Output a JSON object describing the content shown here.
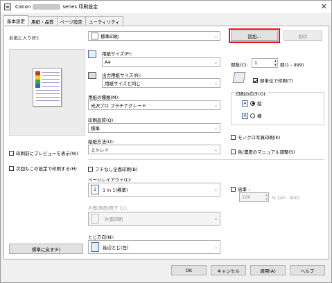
{
  "window": {
    "title_prefix": "Canon",
    "title_suffix": "series 印刷設定",
    "close": "✕"
  },
  "tabs": [
    "基本設定",
    "用紙・品質",
    "ページ設定",
    "ユーティリティ"
  ],
  "favorites": {
    "label": "お気に入り(E):",
    "value": "標準印刷",
    "add_button": "追加...",
    "delete_button": "削除"
  },
  "paper_size": {
    "label": "用紙サイズ(P):",
    "value": "A4"
  },
  "output_size": {
    "label": "出力用紙サイズ(R):",
    "value": "用紙サイズと同じ"
  },
  "media_type": {
    "label": "用紙の種類(M):",
    "value": "光沢プロ プラチナグレード"
  },
  "quality": {
    "label": "印刷品質(Q):",
    "value": "標準"
  },
  "paper_source": {
    "label": "給紙方法(U):",
    "value": "上トレイ"
  },
  "copies": {
    "label": "部数(C):",
    "value": "1",
    "range": "部(1 - 999)",
    "collate_label": "部単位で印刷(T)",
    "collate_checked": true
  },
  "orientation": {
    "label": "印刷の向き(O):",
    "portrait": "縦",
    "landscape": "横",
    "selected": "portrait"
  },
  "preview_checkbox": "印刷前にプレビューを表示(W)",
  "reuse_checkbox": "次回もこの設定で印刷する(H)",
  "mono_photo": "モノクロ写真印刷(K)",
  "manual_color": "色/濃度のマニュアル調整(S)",
  "borderless": "フチなし全面印刷(B)",
  "page_layout": {
    "label": "ページレイアウト(L):",
    "icon_num": "1",
    "value": "1 in 1(標準)"
  },
  "scale": {
    "label": "倍率 :",
    "value": "100",
    "range": "% (20 - 400)"
  },
  "duplex": {
    "label": "片面/両面/冊子 (1):",
    "value": "片面印刷"
  },
  "binding": {
    "label": "とじ方向(N):",
    "value": "長辺とじ(左)"
  },
  "defaults_button": "標準に戻す(F)",
  "footer": {
    "ok": "OK",
    "cancel": "キャンセル",
    "apply": "適用(A)",
    "help": "ヘルプ"
  },
  "colors": {
    "highlight": "#e8141b"
  }
}
